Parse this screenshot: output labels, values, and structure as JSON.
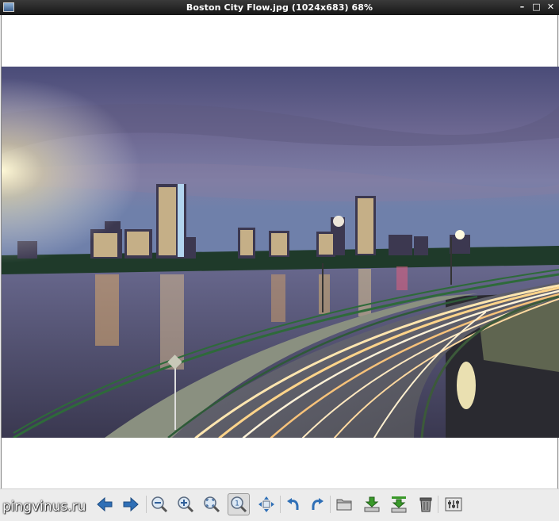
{
  "window": {
    "title": "Boston City Flow.jpg (1024x683) 68%",
    "controls": [
      "minimize",
      "maximize",
      "close"
    ]
  },
  "toolbar": {
    "buttons": [
      {
        "name": "back-button",
        "icon": "arrow-left-icon"
      },
      {
        "name": "forward-button",
        "icon": "arrow-right-icon"
      },
      {
        "name": "zoom-out-button",
        "icon": "zoom-out-icon"
      },
      {
        "name": "zoom-in-button",
        "icon": "zoom-in-icon"
      },
      {
        "name": "zoom-fit-button",
        "icon": "zoom-fit-icon"
      },
      {
        "name": "zoom-original-button",
        "icon": "zoom-1to1-icon",
        "pressed": true
      },
      {
        "name": "fullscreen-button",
        "icon": "move-arrows-icon"
      },
      {
        "name": "rotate-left-button",
        "icon": "rotate-left-icon"
      },
      {
        "name": "rotate-right-button",
        "icon": "rotate-right-icon"
      },
      {
        "name": "open-button",
        "icon": "folder-icon"
      },
      {
        "name": "save-button",
        "icon": "save-icon"
      },
      {
        "name": "save-as-button",
        "icon": "save-as-icon"
      },
      {
        "name": "delete-button",
        "icon": "trash-icon"
      },
      {
        "name": "preferences-button",
        "icon": "preferences-icon"
      }
    ]
  },
  "watermark": "pingvinus.ru",
  "colors": {
    "titlebar": "#1e1e1e",
    "toolbar": "#ececec",
    "arrow_blue": "#2f6fb6",
    "save_green": "#3a9a2a"
  }
}
